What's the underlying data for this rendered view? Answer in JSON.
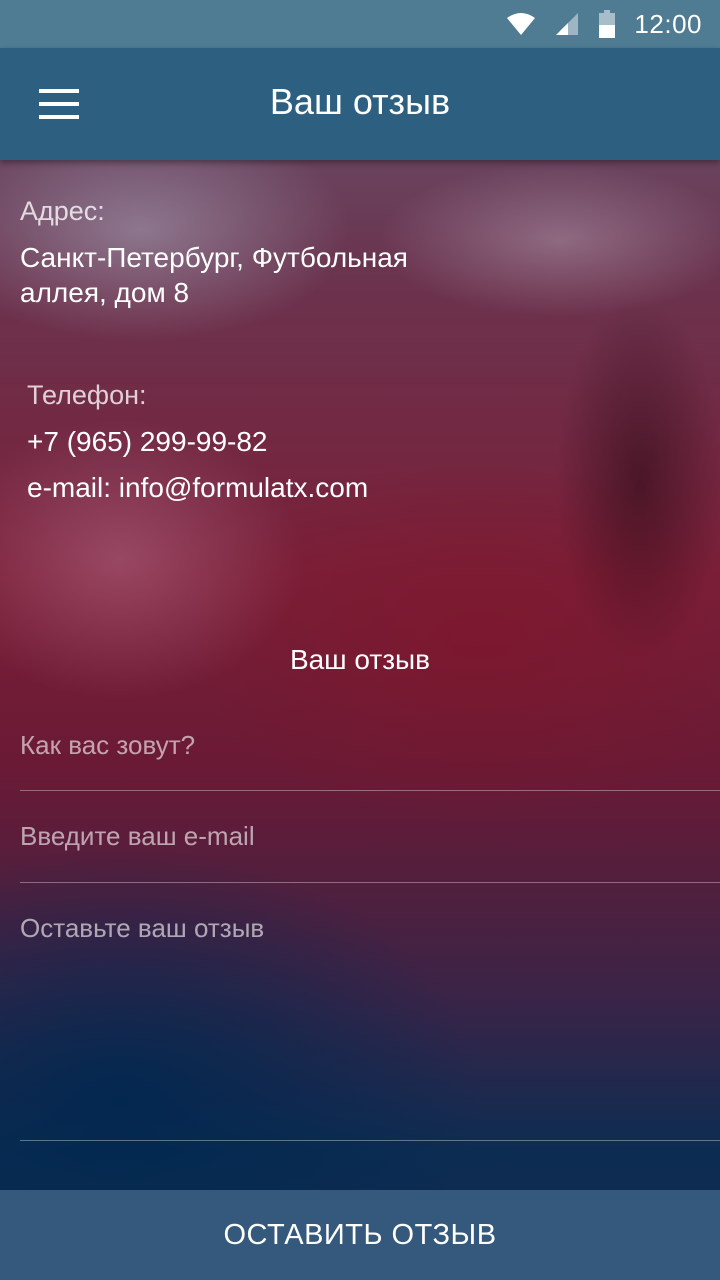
{
  "status_bar": {
    "time": "12:00",
    "icons": [
      "wifi-icon",
      "cellular-signal-icon",
      "battery-icon"
    ]
  },
  "app_bar": {
    "menu_icon": "hamburger-menu-icon",
    "title": "Ваш отзыв"
  },
  "contacts": {
    "address_label": "Адрес:",
    "address_line1": "Санкт-Петербург, Футбольная",
    "address_line2": "аллея, дом 8",
    "phone_label": "Телефон:",
    "phone": "+7 (965) 299-99-82",
    "email": "e-mail: info@formulatx.com"
  },
  "feedback_form": {
    "title": "Ваш отзыв",
    "name_placeholder": "Как вас зовут?",
    "name_value": "",
    "email_placeholder": "Введите ваш e-mail",
    "email_value": "",
    "message_placeholder": "Оставьте ваш отзыв",
    "message_value": "",
    "submit_label": "ОСТАВИТЬ ОТЗЫВ"
  },
  "colors": {
    "status_bar": "#4f7b93",
    "app_bar": "#2d5f80",
    "submit_button": "#34597c",
    "text": "#ffffff"
  }
}
